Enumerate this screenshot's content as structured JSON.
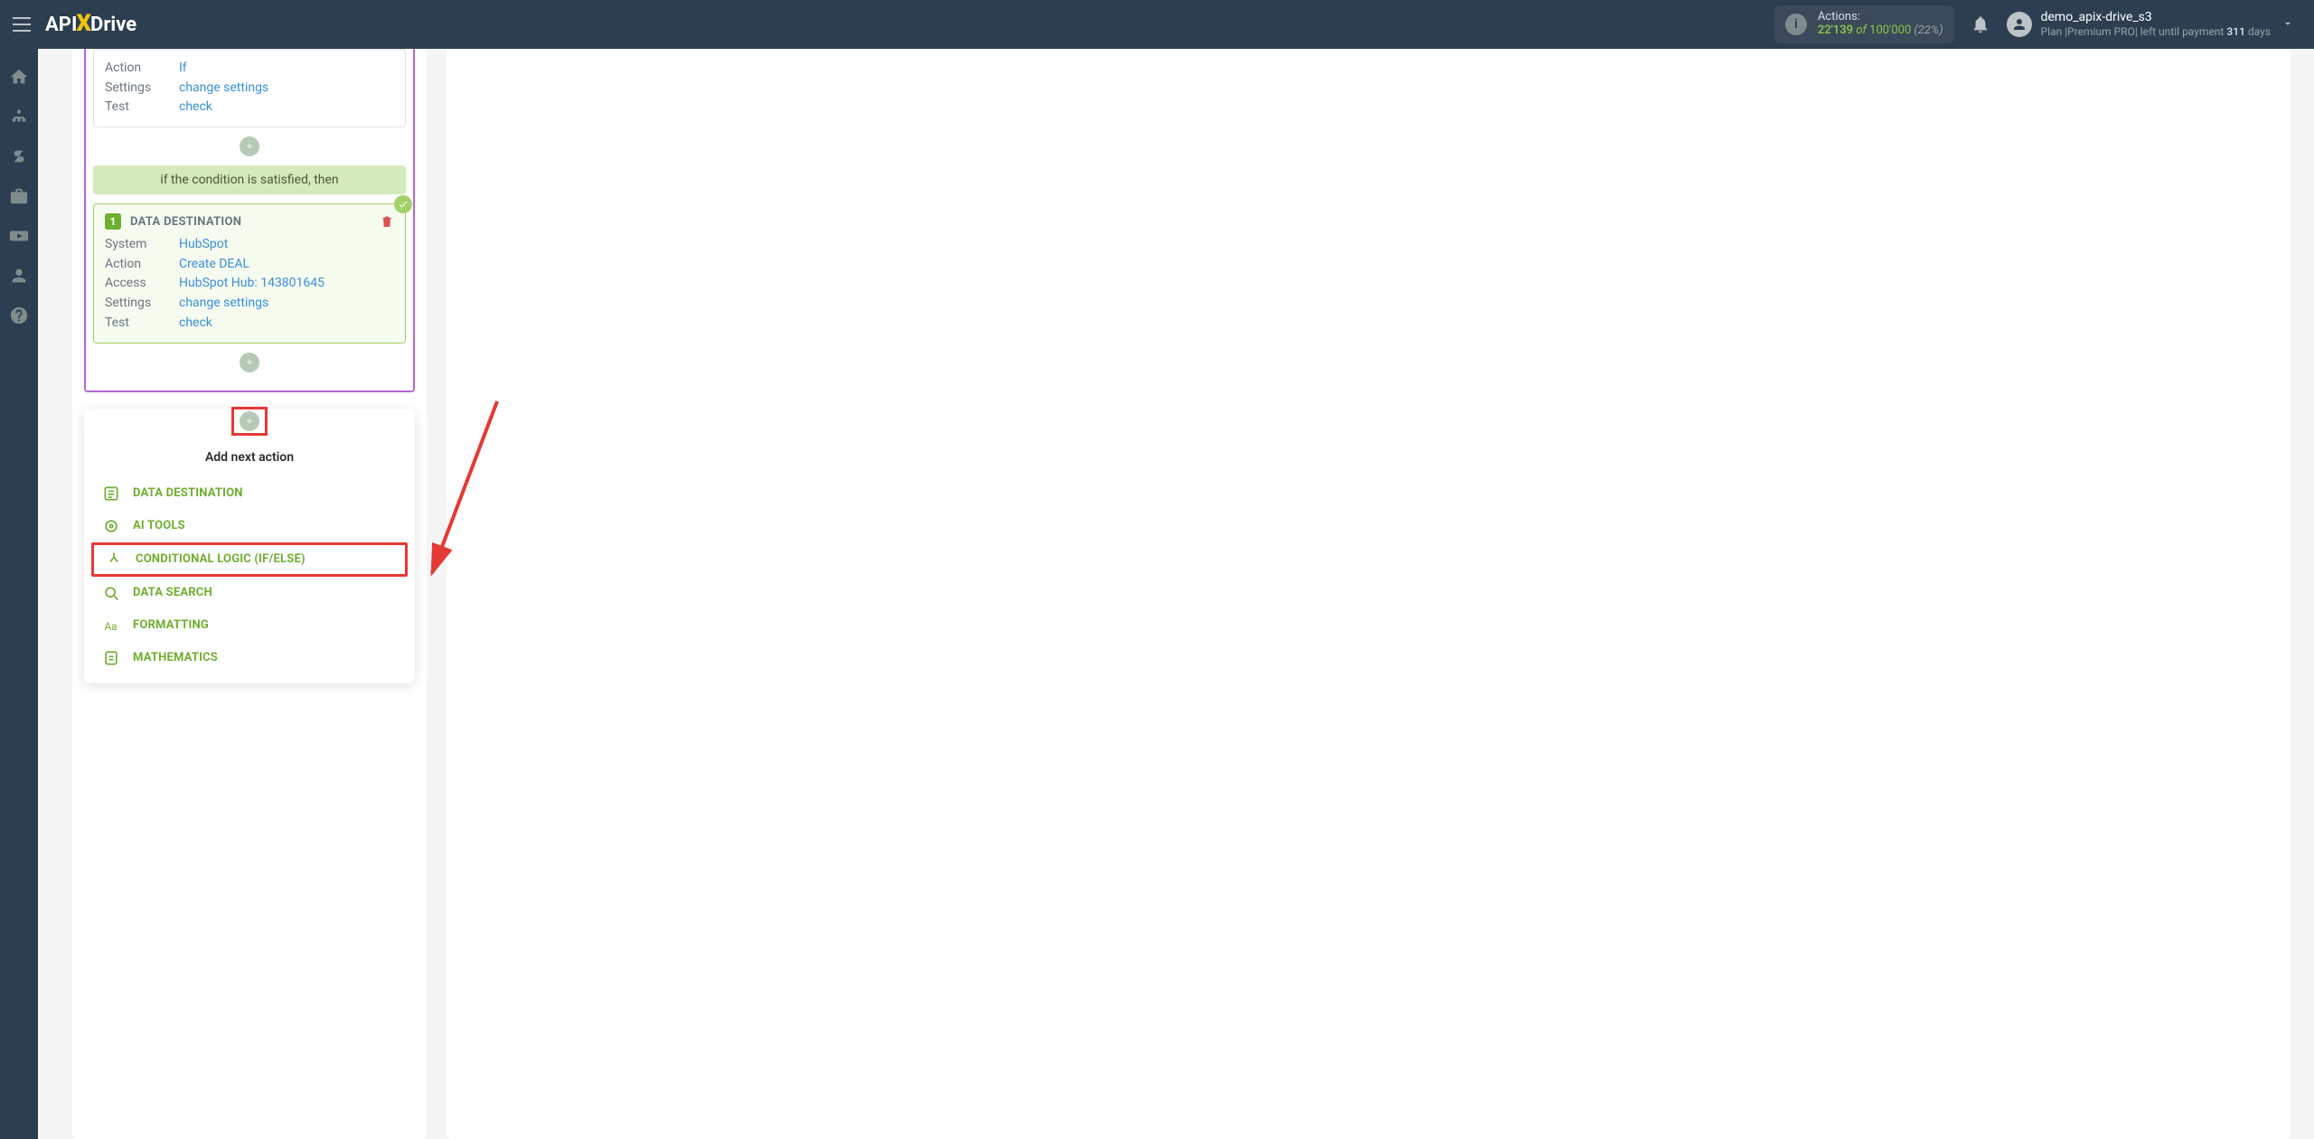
{
  "header": {
    "logo_a": "API",
    "logo_x": "X",
    "logo_b": "Drive",
    "actions_label": "Actions:",
    "actions_count": "22'139",
    "actions_of": "of",
    "actions_total": "100'000",
    "actions_pct": "(22%)",
    "user_name": "demo_apix-drive_s3",
    "plan_prefix": "Plan |Premium PRO| left until payment",
    "plan_days_num": "311",
    "plan_days_unit": "days"
  },
  "if_block": {
    "rows": [
      {
        "label": "Action",
        "value": "If"
      },
      {
        "label": "Settings",
        "value": "change settings"
      },
      {
        "label": "Test",
        "value": "check"
      }
    ]
  },
  "satisfied": "if the condition is satisfied, then",
  "dest": {
    "num": "1",
    "title": "DATA DESTINATION",
    "rows": [
      {
        "label": "System",
        "value": "HubSpot"
      },
      {
        "label": "Action",
        "value": "Create DEAL"
      },
      {
        "label": "Access",
        "value": "HubSpot Hub: 143801645"
      },
      {
        "label": "Settings",
        "value": "change settings"
      },
      {
        "label": "Test",
        "value": "check"
      }
    ]
  },
  "add_panel": {
    "title": "Add next action",
    "items": [
      {
        "label": "DATA DESTINATION",
        "icon": "list"
      },
      {
        "label": "AI TOOLS",
        "icon": "gear"
      },
      {
        "label": "CONDITIONAL LOGIC (IF/ELSE)",
        "icon": "branch"
      },
      {
        "label": "DATA SEARCH",
        "icon": "search"
      },
      {
        "label": "FORMATTING",
        "icon": "aa"
      },
      {
        "label": "MATHEMATICS",
        "icon": "calc"
      }
    ]
  }
}
